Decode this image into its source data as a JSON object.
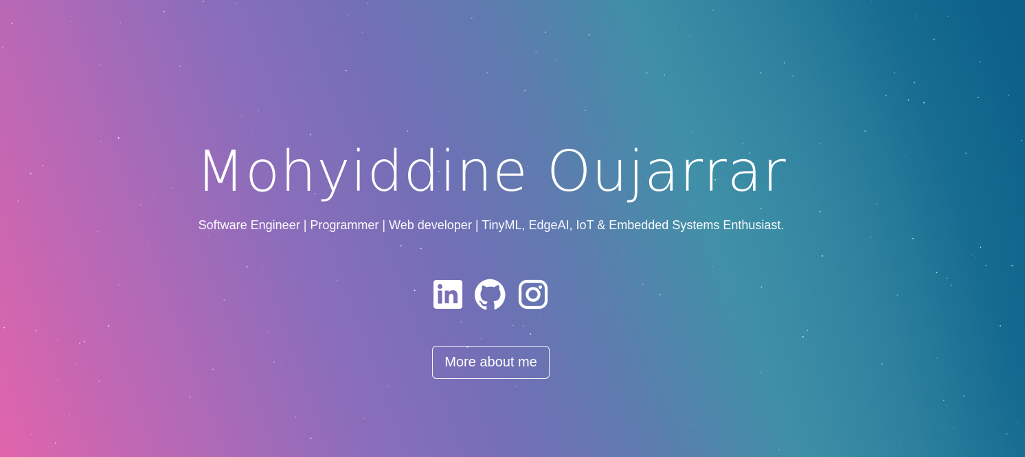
{
  "hero": {
    "name": "Mohyiddine Oujarrar",
    "tagline": "Software Engineer | Programmer | Web developer | TinyML, EdgeAI, IoT & Embedded Systems Enthusiast.",
    "cta_label": "More about me"
  },
  "socials": [
    {
      "network": "LinkedIn",
      "icon": "linkedin-icon"
    },
    {
      "network": "GitHub",
      "icon": "github-icon"
    },
    {
      "network": "Instagram",
      "icon": "instagram-icon"
    }
  ],
  "colors": {
    "gradient_start": "#e064ab",
    "gradient_mid": "#726fb6",
    "gradient_teal": "#3f8ea7",
    "gradient_end": "#0b5f88",
    "text": "#ffffff"
  }
}
